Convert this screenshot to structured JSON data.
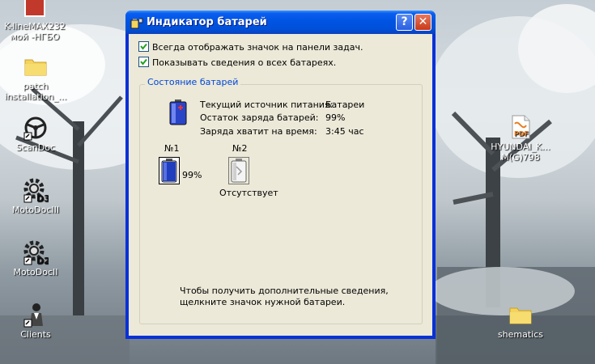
{
  "desktop": {
    "icons": [
      {
        "name": "kline-icon",
        "label_line1": "K-lineMAX232",
        "label_line2": "мой -НГБО"
      },
      {
        "name": "patch-folder-icon",
        "label_line1": "patch",
        "label_line2": "installation_..."
      },
      {
        "name": "scandoc-icon",
        "label_line1": "ScanDoc",
        "label_line2": ""
      },
      {
        "name": "motodociii-icon",
        "label_line1": "MotoDocIII",
        "label_line2": ""
      },
      {
        "name": "motodocii-icon",
        "label_line1": "MotoDocII",
        "label_line2": ""
      },
      {
        "name": "clients-icon",
        "label_line1": "Clients",
        "label_line2": ""
      },
      {
        "name": "pdf-icon",
        "label_line1": "HYUNDAI_K...",
        "label_line2": "M(G)798"
      },
      {
        "name": "shematics-folder-icon",
        "label_line1": "shematics",
        "label_line2": ""
      }
    ],
    "pdf_badge": "PDF",
    "motodociii_badge": "D3",
    "motodocii_badge": "D2"
  },
  "window": {
    "title": "Индикатор батарей",
    "help_label": "?",
    "close_label": "✕",
    "options": {
      "always_show_icon": {
        "label": "Всегда отображать значок на панели задач.",
        "checked": true
      },
      "show_all_batteries": {
        "label": "Показывать сведения о всех батареях.",
        "checked": true
      }
    },
    "group_title": "Состояние батарей",
    "info": {
      "source_label": "Текущий источник питания:",
      "source_value": "Батареи",
      "charge_label": "Остаток заряда батарей:",
      "charge_value": "99%",
      "time_label": "Заряда хватит на время:",
      "time_value": "3:45 час"
    },
    "batteries": [
      {
        "title": "№1",
        "status": "99%",
        "level": 0.99
      },
      {
        "title": "№2",
        "status": "Отсутствует",
        "level": 0
      }
    ],
    "hint_line1": "Чтобы получить дополнительные сведения,",
    "hint_line2": "щелкните значок нужной батареи.",
    "colors": {
      "title_bar": "#0054e3",
      "client_bg": "#ece9d8",
      "group_title": "#0046d5",
      "close_button": "#c83a18",
      "battery_fill": "#1f3fbf"
    }
  }
}
